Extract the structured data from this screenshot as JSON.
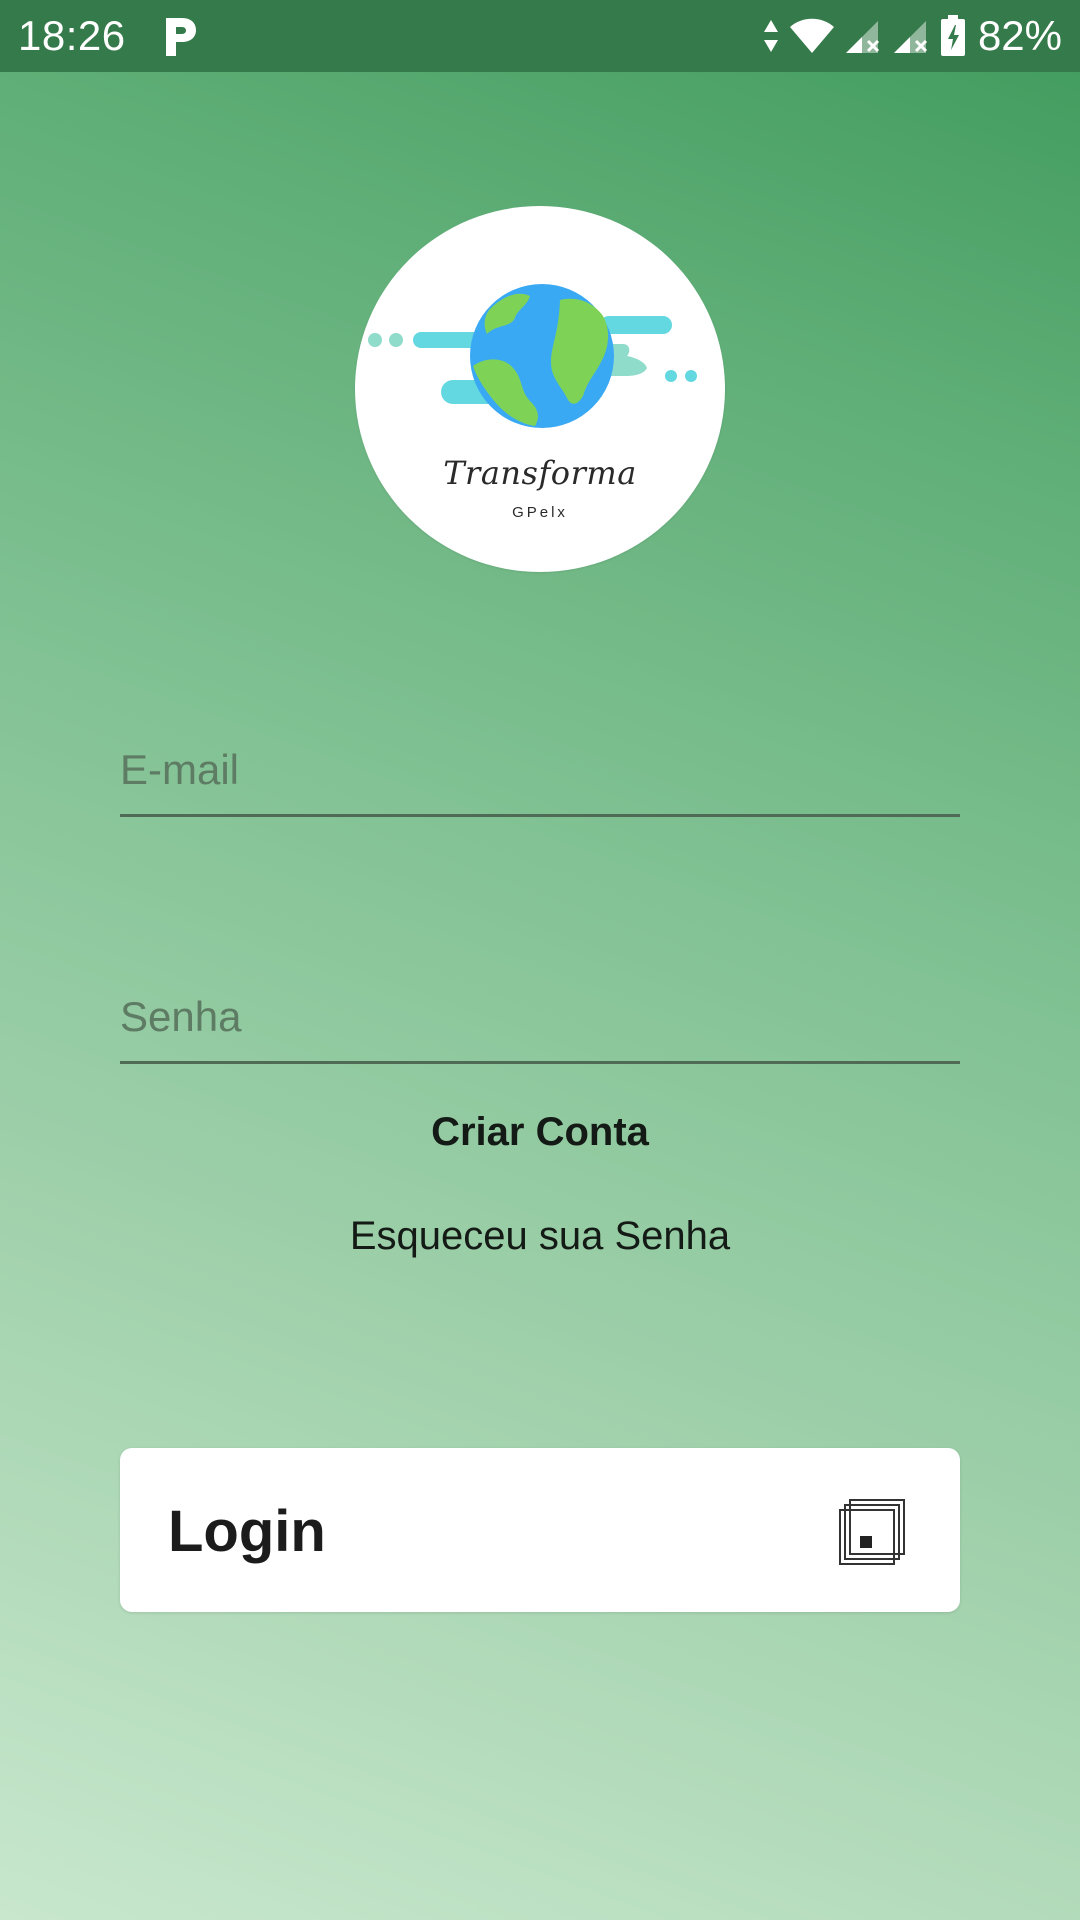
{
  "status_bar": {
    "time": "18:26",
    "battery": "82%",
    "icons": [
      "parking-icon",
      "data-arrows-icon",
      "wifi-icon",
      "signal-no-service-icon",
      "signal-no-service-icon",
      "battery-charging-icon"
    ]
  },
  "logo": {
    "brand": "Transforma",
    "sub": "GPelx",
    "icon": "earth-globe-icon"
  },
  "form": {
    "email_placeholder": "E-mail",
    "password_placeholder": "Senha",
    "create_account": "Criar Conta",
    "forgot_password": "Esqueceu sua Senha",
    "login_label": "Login",
    "login_icon": "stacked-squares-icon"
  },
  "colors": {
    "status_bar": "#357a4a",
    "gradient_top": "#3f9a5c",
    "gradient_bottom": "#c8e7cd",
    "underline": "#4f6a55"
  }
}
